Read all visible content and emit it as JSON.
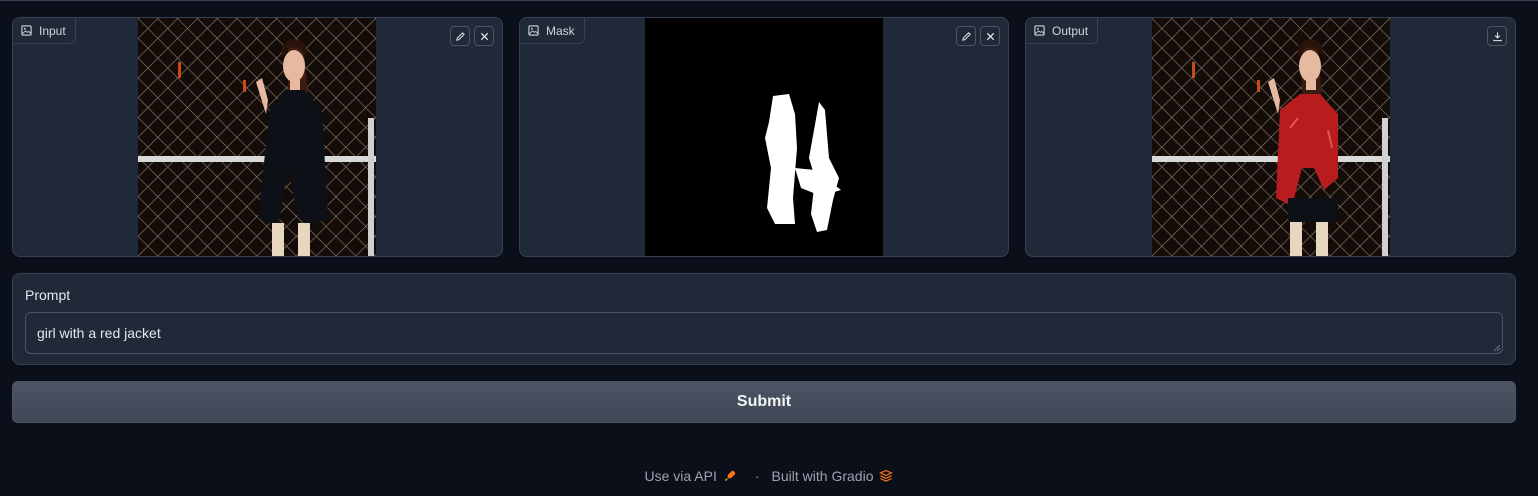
{
  "panels": {
    "input": {
      "label": "Input",
      "icon": "image-icon"
    },
    "mask": {
      "label": "Mask",
      "icon": "image-icon"
    },
    "output": {
      "label": "Output",
      "icon": "image-icon"
    }
  },
  "prompt": {
    "label": "Prompt",
    "value": "girl with a red jacket"
  },
  "submit_label": "Submit",
  "footer": {
    "api_link": "Use via API",
    "separator": "·",
    "built_with": "Built with Gradio"
  },
  "colors": {
    "background": "#0b0f19",
    "panel": "#1f2937",
    "border": "#374151",
    "button": "#4b5563",
    "accent": "#f97316",
    "jacket_input": "#0d1117",
    "jacket_output": "#b91c1c"
  }
}
